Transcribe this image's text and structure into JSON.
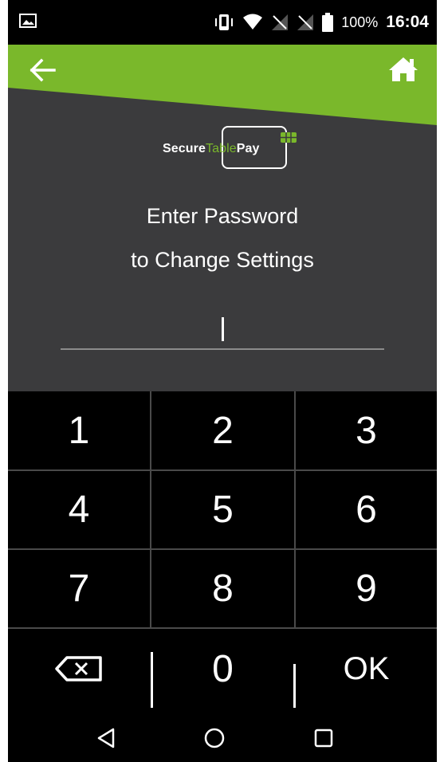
{
  "status_bar": {
    "battery_percent": "100%",
    "time": "16:04",
    "icons": [
      "image-notification-icon",
      "vibrate-icon",
      "wifi-icon",
      "no-signal-icon",
      "no-signal-icon",
      "battery-icon"
    ]
  },
  "header": {
    "back_icon": "arrow-left-icon",
    "home_icon": "home-icon",
    "accent_color": "#7ab82b",
    "background_color": "#3b3b3d"
  },
  "logo": {
    "part1": "Secure",
    "part2": "Table",
    "part3": "Pay"
  },
  "prompt": {
    "line1": "Enter Password",
    "line2": "to Change Settings"
  },
  "keypad": {
    "keys": [
      "1",
      "2",
      "3",
      "4",
      "5",
      "6",
      "7",
      "8",
      "9",
      "0"
    ],
    "backspace_icon": "backspace-icon",
    "ok_label": "OK"
  },
  "nav_bar": {
    "icons": [
      "back-triangle-icon",
      "home-circle-icon",
      "recents-square-icon"
    ]
  }
}
